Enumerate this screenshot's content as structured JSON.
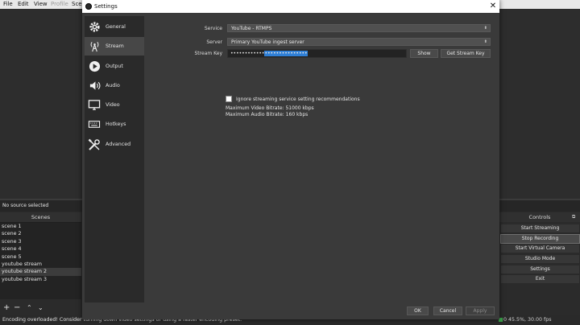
{
  "menubar": {
    "items": [
      "File",
      "Edit",
      "View",
      "Profile",
      "Sce"
    ]
  },
  "source_bar": {
    "text": "No source selected"
  },
  "scenes": {
    "header": "Scenes",
    "items": [
      "scene 1",
      "scene 2",
      "scene 3",
      "scene 4",
      "scene 5",
      "youtube stream",
      "youtube stream 2",
      "youtube stream 3"
    ],
    "selected_index": 6
  },
  "controls": {
    "header": "Controls",
    "buttons": [
      "Start Streaming",
      "Stop Recording",
      "Start Virtual Camera",
      "Studio Mode",
      "Settings",
      "Exit"
    ],
    "active_index": 1
  },
  "status": {
    "message": "Encoding overloaded! Consider turning down video settings or using a faster encoding preset.",
    "right_text": "0 45.5%, 30.00 fps"
  },
  "dialog": {
    "title": "Settings",
    "close_label": "✕",
    "sidebar": [
      {
        "label": "General",
        "icon": "gear-icon"
      },
      {
        "label": "Stream",
        "icon": "antenna-icon"
      },
      {
        "label": "Output",
        "icon": "play-icon"
      },
      {
        "label": "Audio",
        "icon": "speaker-icon"
      },
      {
        "label": "Video",
        "icon": "monitor-icon"
      },
      {
        "label": "Hotkeys",
        "icon": "keyboard-icon"
      },
      {
        "label": "Advanced",
        "icon": "tools-icon"
      }
    ],
    "selected_index": 1,
    "stream": {
      "service_label": "Service",
      "service_value": "YouTube - RTMPS",
      "server_label": "Server",
      "server_value": "Primary YouTube ingest server",
      "key_label": "Stream Key",
      "key_masked": "••••••••••••",
      "key_selected": "•••••••••••••••",
      "show_label": "Show",
      "get_key_label": "Get Stream Key",
      "ignore_label": "Ignore streaming service setting recommendations",
      "ignore_checked": false,
      "max_video": "Maximum Video Bitrate: 51000 kbps",
      "max_audio": "Maximum Audio Bitrate: 160 kbps"
    },
    "footer": {
      "ok": "OK",
      "cancel": "Cancel",
      "apply": "Apply"
    }
  }
}
